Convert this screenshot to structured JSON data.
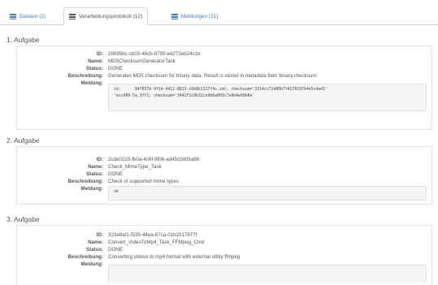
{
  "tabs": [
    {
      "label": "Dateien (2)",
      "icon": "list-icon"
    },
    {
      "label": "Verarbeitungsprotokoll (12)",
      "icon": "list-icon"
    },
    {
      "label": "Meldungen (21)",
      "icon": "list-icon"
    }
  ],
  "field_labels": {
    "id": "ID:",
    "name": "Name:",
    "status": "Status:",
    "description": "Beschreibung:",
    "message": "Meldung:"
  },
  "tasks": [
    {
      "title": "1. Aufgabe",
      "id": "28695bc-cb03-46cb-8795-ed273a624c1b",
      "name": "MD5ChecksumGeneratorTask",
      "status": "DONE",
      "description": "Generates MD5 checksum for binary data. Result is stored in metadata field 'binary.checksum'",
      "message_lines": [
        "id:      847657b-9f14-4412-8813-c0b8b1317f4c.xml; checksum='3314cc72480b7f4279197b4e5c4a43'",
        "'ecc489-5a.3ff1; checksum='3442f1c9b32ce9b6a003c7a9b4e09b6e'"
      ]
    },
    {
      "title": "2. Aufgabe",
      "id": "2cde0210-fb0a-4c6f-8f06-ad45c0d05a68",
      "name": "Check_MimeType_Task",
      "status": "DONE",
      "description": "Check of supported mime types",
      "message_lines": [
        "ok"
      ]
    },
    {
      "title": "3. Aufgabe",
      "id": "323e8af1-f535-44ea-87ca-01b2317877f",
      "name": "Convert_VideoToMp4_Task_FFMpeg_Cmd",
      "status": "DONE",
      "description": "Converting videos to mp4 format with external utility ffmpeg",
      "message_lines": []
    }
  ],
  "colors": {
    "link": "#3d7fc4",
    "text": "#555555",
    "border": "#e3e3e3",
    "code_bg": "#f5f5f5"
  }
}
